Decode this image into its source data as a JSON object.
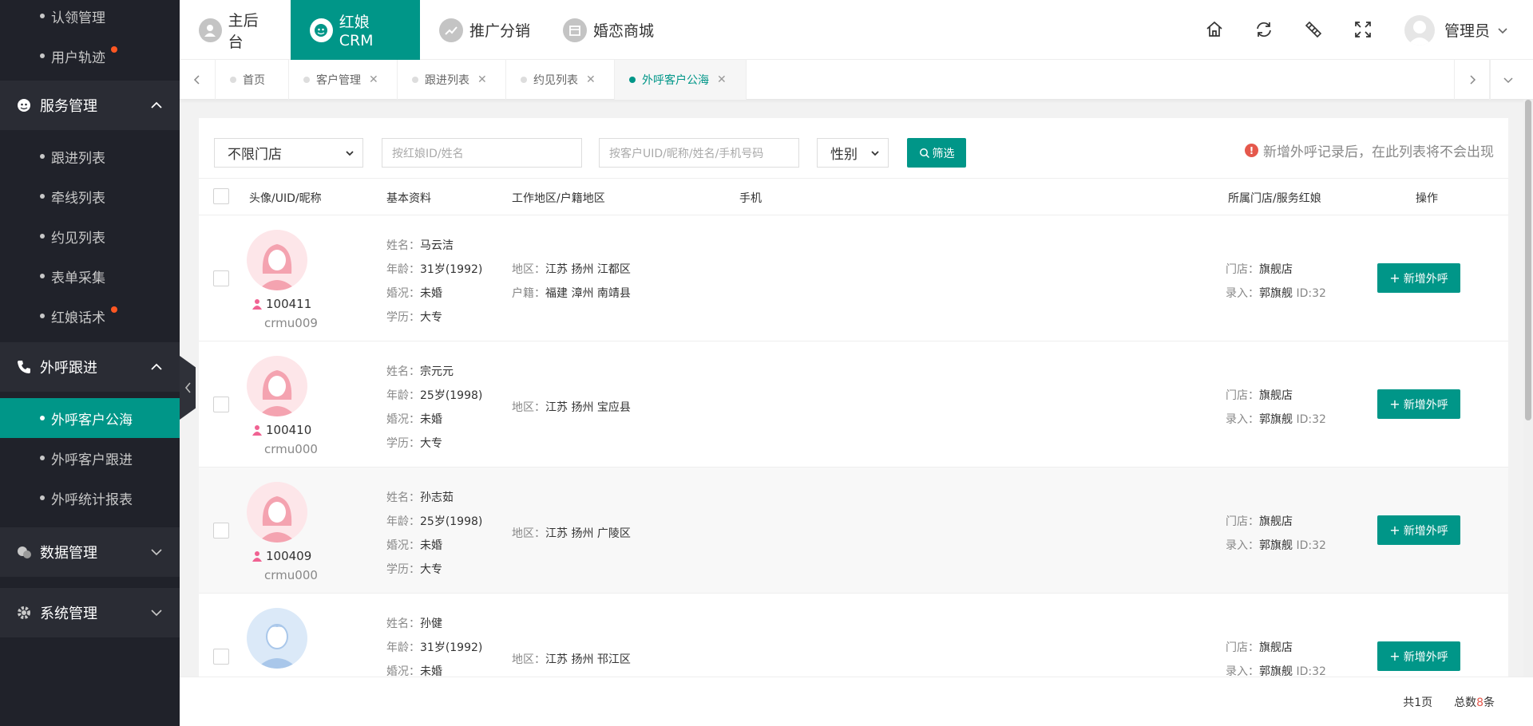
{
  "sidebar": {
    "top_items": [
      {
        "label": "认领管理",
        "badge": false
      },
      {
        "label": "用户轨迹",
        "badge": true
      }
    ],
    "groups": [
      {
        "label": "服务管理",
        "icon": "service-icon",
        "expanded": true,
        "items": [
          {
            "label": "跟进列表",
            "badge": false
          },
          {
            "label": "牵线列表",
            "badge": false
          },
          {
            "label": "约见列表",
            "badge": false
          },
          {
            "label": "表单采集",
            "badge": false
          },
          {
            "label": "红娘话术",
            "badge": true
          }
        ]
      },
      {
        "label": "外呼跟进",
        "icon": "phone-icon",
        "expanded": true,
        "items": [
          {
            "label": "外呼客户公海",
            "active": true
          },
          {
            "label": "外呼客户跟进"
          },
          {
            "label": "外呼统计报表"
          }
        ]
      },
      {
        "label": "数据管理",
        "icon": "data-icon",
        "expanded": false
      },
      {
        "label": "系统管理",
        "icon": "gear-icon",
        "expanded": false
      }
    ]
  },
  "header": {
    "nav": [
      {
        "label": "主后台",
        "active": false
      },
      {
        "label": "红娘CRM",
        "active": true
      },
      {
        "label": "推广分销",
        "active": false
      },
      {
        "label": "婚恋商城",
        "active": false
      }
    ],
    "user": "管理员"
  },
  "tabs": [
    {
      "label": "首页",
      "closable": false
    },
    {
      "label": "客户管理",
      "closable": true
    },
    {
      "label": "跟进列表",
      "closable": true
    },
    {
      "label": "约见列表",
      "closable": true
    },
    {
      "label": "外呼客户公海",
      "closable": true,
      "active": true
    }
  ],
  "filters": {
    "store_select": "不限门店",
    "matchmaker_placeholder": "按红娘ID/姓名",
    "customer_placeholder": "按客户UID/昵称/姓名/手机号码",
    "gender_select": "性别",
    "filter_button": "筛选",
    "notice": "新增外呼记录后，在此列表将不会出现"
  },
  "table": {
    "headers": {
      "avatar": "头像/UID/昵称",
      "basic": "基本资料",
      "region": "工作地区/户籍地区",
      "phone": "手机",
      "store": "所属门店/服务红娘",
      "action": "操作"
    },
    "labels": {
      "name": "姓名：",
      "age": "年龄：",
      "marital": "婚况：",
      "education": "学历：",
      "region": "地区：",
      "hukou": "户籍：",
      "store": "门店：",
      "entry": "录入："
    },
    "rows": [
      {
        "gender": "female",
        "uid": "100411",
        "nick": "crmu009",
        "name": "马云洁",
        "age": "31岁(1992)",
        "marital": "未婚",
        "education": "大专",
        "region": "江苏 扬州 江都区",
        "hukou": "福建 漳州 南靖县",
        "store": "旗舰店",
        "entry": "郭旗舰",
        "entry_id": "ID:32",
        "action": "新增外呼"
      },
      {
        "gender": "female",
        "uid": "100410",
        "nick": "crmu000",
        "name": "宗元元",
        "age": "25岁(1998)",
        "marital": "未婚",
        "education": "大专",
        "region": "江苏 扬州 宝应县",
        "hukou": "",
        "store": "旗舰店",
        "entry": "郭旗舰",
        "entry_id": "ID:32",
        "action": "新增外呼"
      },
      {
        "gender": "female",
        "uid": "100409",
        "nick": "crmu000",
        "name": "孙志茹",
        "age": "25岁(1998)",
        "marital": "未婚",
        "education": "大专",
        "region": "江苏 扬州 广陵区",
        "hukou": "",
        "store": "旗舰店",
        "entry": "郭旗舰",
        "entry_id": "ID:32",
        "action": "新增外呼"
      },
      {
        "gender": "male",
        "uid": "",
        "nick": "",
        "name": "孙健",
        "age": "31岁(1992)",
        "marital": "未婚",
        "education": "",
        "region": "江苏 扬州 邗江区",
        "hukou": "",
        "store": "旗舰店",
        "entry": "郭旗舰",
        "entry_id": "ID:32",
        "action": "新增外呼"
      }
    ]
  },
  "footer": {
    "pages_prefix": "共",
    "pages": "1",
    "pages_suffix": "页",
    "total_prefix": "总数",
    "total": "8",
    "total_suffix": "条"
  },
  "colors": {
    "accent": "#009688",
    "sidebar_bg": "#20222a",
    "badge": "#ff5722",
    "notice_icon": "#e5584c"
  }
}
